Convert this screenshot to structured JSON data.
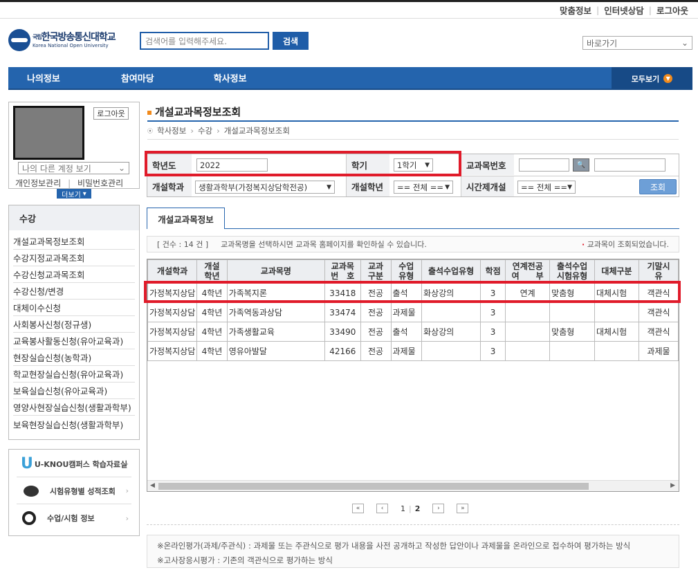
{
  "util_links": [
    "맞춤정보",
    "인터넷상담",
    "로그아웃"
  ],
  "logo": {
    "ko": "한국방송통신대학교",
    "emblem_text": "국립",
    "en": "Korea National Open University"
  },
  "search": {
    "placeholder": "검색어를 입력해주세요.",
    "button": "검색"
  },
  "quick_select": "바로가기",
  "nav": {
    "items": [
      "나의정보",
      "참여마당",
      "학사정보"
    ],
    "all": "모두보기"
  },
  "profile": {
    "logout": "로그아웃",
    "account_select": "나의 다른 계정 보기",
    "link1": "개인정보관리",
    "link2": "비밀번호관리",
    "more": "더보기"
  },
  "side": {
    "title": "수강",
    "items": [
      "개설교과목정보조회",
      "수강지정교과목조회",
      "수강신청교과목조회",
      "수강신청/변경",
      "대체이수신청",
      "사회봉사신청(정규생)",
      "교육봉사활동신청(유아교육과)",
      "현장실습신청(농학과)",
      "학교현장실습신청(유아교육과)",
      "보육실습신청(유아교육과)",
      "영양사현장실습신청(생활과학부)",
      "보육현장실습신청(생활과학부)"
    ]
  },
  "banners": [
    "U-KNOU캠퍼스 학습자료실",
    "시험유형별 성적조회",
    "수업/시험 정보"
  ],
  "page": {
    "title": "개설교과목정보조회",
    "crumb": [
      "학사정보",
      "수강",
      "개설교과목정보조회"
    ]
  },
  "form": {
    "year_label": "학년도",
    "year_value": "2022",
    "semester_label": "학기",
    "semester_value": "1학기",
    "course_no_label": "교과목번호",
    "dept_label": "개설학과",
    "dept_value": "생활과학부(가정복지상담학전공)",
    "grade_label": "개설학년",
    "grade_value": "== 전체 ==",
    "time_label": "시간제개설",
    "time_value": "== 전체 ==",
    "query_button": "조회"
  },
  "tab": "개설교과목정보",
  "info": {
    "count": "[ 건수 : 14 건 ]",
    "msg": "교과목명을 선택하시면 교과목 홈페이지를 확인하실 수 있습니다.",
    "msg2": "교과목이 조회되었습니다."
  },
  "table": {
    "headers": [
      "개설학과",
      "개설\n학년",
      "교과목명",
      "교과목\n번　호",
      "교과\n구분",
      "수업\n유형",
      "출석수업유형",
      "학점",
      "연계전공\n여　　부",
      "출석수업\n시험유형",
      "대체구분",
      "기말시\n유"
    ],
    "rows": [
      [
        "가정복지상담",
        "4학년",
        "가족복지론",
        "33418",
        "전공",
        "출석",
        "화상강의",
        "3",
        "연계",
        "맞춤형",
        "대체시험",
        "객관식"
      ],
      [
        "가정복지상담",
        "4학년",
        "가족역동과상담",
        "33474",
        "전공",
        "과제물",
        "",
        "3",
        "",
        "",
        "",
        "객관식"
      ],
      [
        "가정복지상담",
        "4학년",
        "가족생활교육",
        "33490",
        "전공",
        "출석",
        "화상강의",
        "3",
        "",
        "맞춤형",
        "대체시험",
        "객관식"
      ],
      [
        "가정복지상담",
        "4학년",
        "영유아발달",
        "42166",
        "전공",
        "과제물",
        "",
        "3",
        "",
        "",
        "",
        "과제물"
      ]
    ]
  },
  "pager": {
    "pages": [
      "1",
      "2"
    ],
    "current": "2"
  },
  "notes": [
    "※온라인평가(과제/주관식) : 과제물 또는 주관식으로 평가 내용을 사전 공개하고 작성한 답안이나 과제물을 온라인으로 접수하여 평가하는 방식",
    "※고사장응시평가 : 기존의 객관식으로 평가하는 방식"
  ],
  "colors": {
    "primary": "#2464ad",
    "highlight": "#e01b2a",
    "accent": "#f18a1c"
  }
}
